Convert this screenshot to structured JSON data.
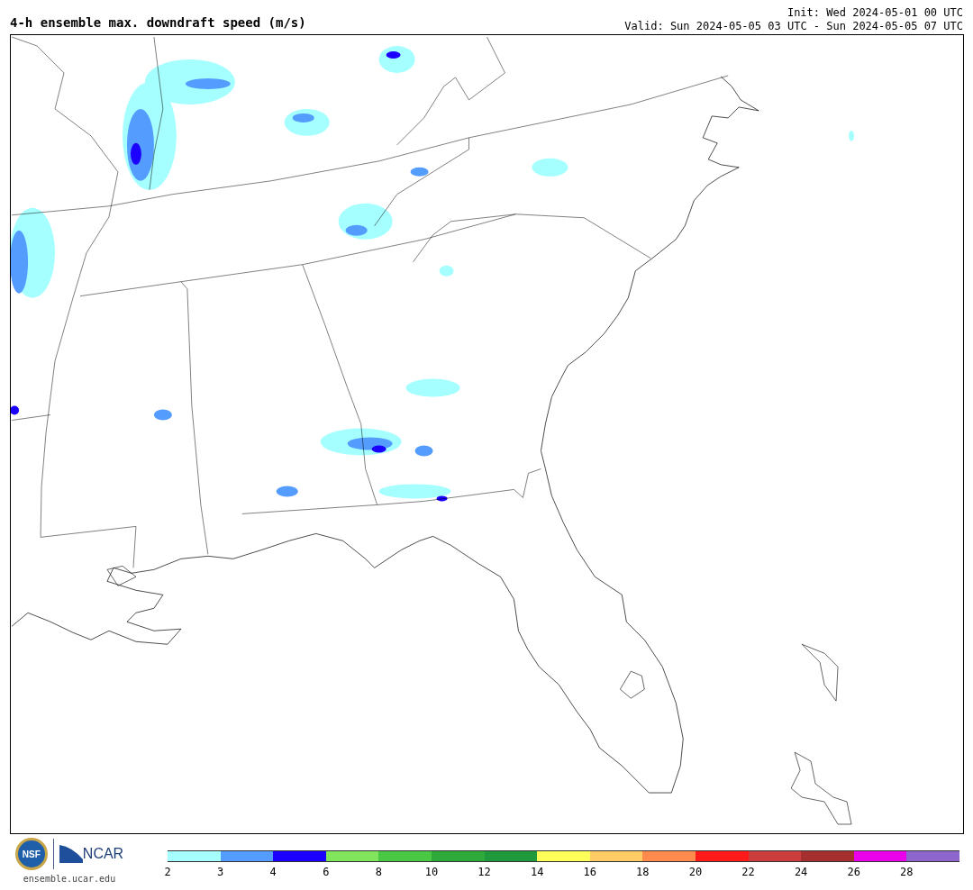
{
  "header": {
    "title": "4-h ensemble max. downdraft speed (m/s)",
    "init": "Init: Wed 2024-05-01 00 UTC",
    "valid": "Valid: Sun 2024-05-05 03 UTC - Sun 2024-05-05 07 UTC"
  },
  "footer": {
    "logo_left": "NSF",
    "logo_right": "NCAR",
    "url": "ensemble.ucar.edu"
  },
  "legend": {
    "bins": [
      {
        "color": "#a6ffff"
      },
      {
        "color": "#559cff"
      },
      {
        "color": "#1b00ff"
      },
      {
        "color": "#80e55c"
      },
      {
        "color": "#4bc843"
      },
      {
        "color": "#2daa39"
      },
      {
        "color": "#1e9a3d"
      },
      {
        "color": "#ffff5a"
      },
      {
        "color": "#ffcc66"
      },
      {
        "color": "#ff8a4d"
      },
      {
        "color": "#ff1a1a"
      },
      {
        "color": "#cc3d3d"
      },
      {
        "color": "#a52e2e"
      },
      {
        "color": "#eb00eb"
      },
      {
        "color": "#8c66cc"
      }
    ],
    "ticks": [
      "2",
      "3",
      "4",
      "6",
      "8",
      "10",
      "12",
      "14",
      "16",
      "18",
      "20",
      "22",
      "24",
      "26",
      "28"
    ]
  }
}
